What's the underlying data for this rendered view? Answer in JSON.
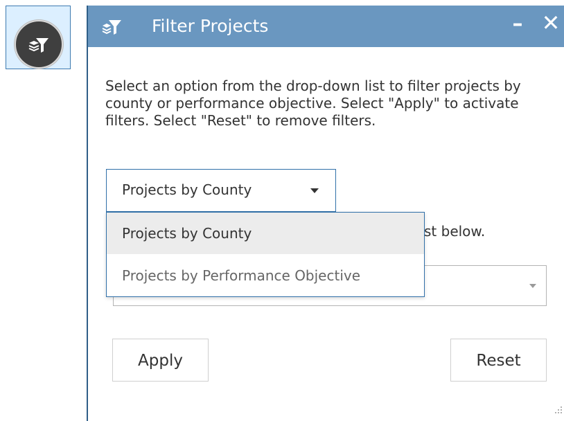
{
  "panel": {
    "title": "Filter Projects",
    "minimize_label": "–",
    "close_label": "✕",
    "description": "Select an option from the drop-down list to filter projects by county or performance objective. Select \"Apply\" to activate filters. Select \"Reset\" to remove filters."
  },
  "filter_type": {
    "selected": "Projects by County",
    "options": [
      "Projects by County",
      "Projects by Performance Objective"
    ]
  },
  "hint_text": "st below.",
  "buttons": {
    "apply": "Apply",
    "reset": "Reset"
  },
  "colors": {
    "titlebar": "#6a97c0",
    "panel_border": "#2f5e87",
    "launcher_bg": "#dcefff",
    "dropdown_border": "#2f6fa8"
  },
  "icons": {
    "launcher": "filter-layers-icon",
    "title": "filter-layers-icon",
    "caret": "chevron-down-icon"
  }
}
